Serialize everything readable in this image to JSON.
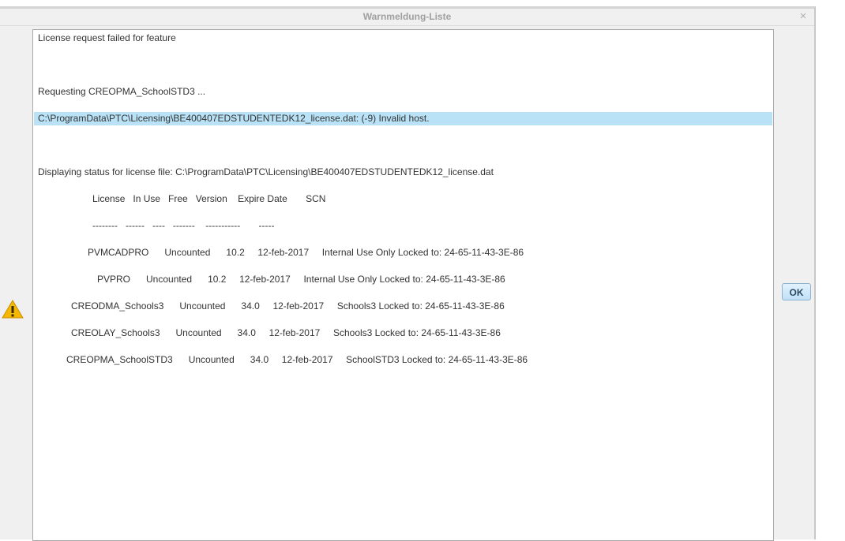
{
  "window": {
    "title": "Warnmeldung-Liste",
    "close_symbol": "×"
  },
  "lines": [
    "License request failed for feature",
    "Requesting CREOPMA_SchoolSTD3 ...",
    "C:\\ProgramData\\PTC\\Licensing\\BE400407EDSTUDENTEDK12_license.dat: (-9) Invalid host.",
    "Displaying status for license file: C:\\ProgramData\\PTC\\Licensing\\BE400407EDSTUDENTEDK12_license.dat",
    "License   In Use   Free   Version    Expire Date       SCN",
    "--------   ------   ----   -------    -----------       -----",
    "PVMCADPRO      Uncounted      10.2     12-feb-2017     Internal Use Only Locked to: 24-65-11-43-3E-86",
    "PVPRO      Uncounted      10.2     12-feb-2017     Internal Use Only Locked to: 24-65-11-43-3E-86",
    "CREODMA_Schools3      Uncounted      34.0     12-feb-2017     Schools3 Locked to: 24-65-11-43-3E-86",
    "CREOLAY_Schools3      Uncounted      34.0     12-feb-2017     Schools3 Locked to: 24-65-11-43-3E-86",
    "CREOPMA_SchoolSTD3      Uncounted      34.0     12-feb-2017     SchoolSTD3 Locked to: 24-65-11-43-3E-86"
  ],
  "selected_line_index": 2,
  "buttons": {
    "ok": "OK"
  },
  "icons": {
    "warning": "warning-icon",
    "close": "close-icon"
  },
  "colors": {
    "selection": "#b9e2f6",
    "warning_fill": "#f5b800"
  }
}
